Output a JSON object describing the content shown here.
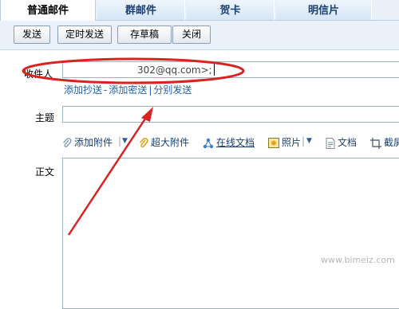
{
  "tabs": [
    {
      "label": "普通邮件",
      "active": true
    },
    {
      "label": "群邮件",
      "active": false
    },
    {
      "label": "贺卡",
      "active": false
    },
    {
      "label": "明信片",
      "active": false
    }
  ],
  "toolbar": {
    "send": "发送",
    "scheduled_send": "定时发送",
    "save_draft": "存草稿",
    "close": "关闭"
  },
  "form": {
    "recipient_label": "收件人",
    "recipient_value": "302@qq.com>;",
    "cc_links": [
      "添加抄送",
      "添加密送",
      "分别发送"
    ],
    "subject_label": "主题",
    "subject_value": "",
    "body_label": "正文"
  },
  "attachments_bar": {
    "add_attachment": "添加附件",
    "large_attachment": "超大附件",
    "online_doc": "在线文档",
    "photo": "照片",
    "document": "文档",
    "screenshot": "截屏"
  },
  "watermark": "www.bimeiz.com",
  "colors": {
    "annotation_red": "#d9231f",
    "link_blue": "#1f5fa8",
    "toolbar_bg": "#eaf1fa"
  }
}
